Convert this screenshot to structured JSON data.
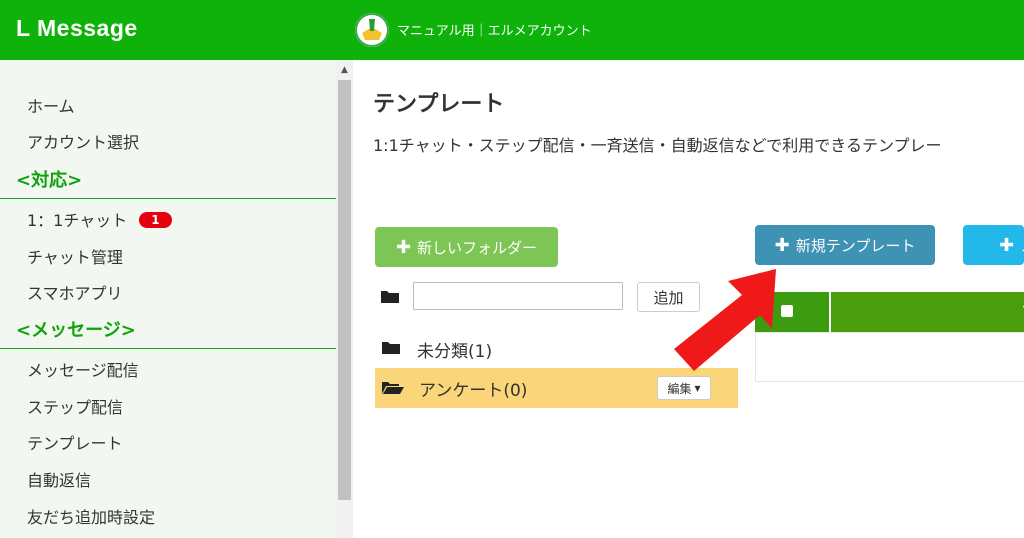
{
  "header": {
    "logo": "L Message",
    "account_name": "マニュアル用｜エルメアカウント"
  },
  "sidebar": {
    "home": "ホーム",
    "account_select": "アカウント選択",
    "section_support": "<対応>",
    "chat": "1：1チャット",
    "chat_badge": "1",
    "chat_manage": "チャット管理",
    "smartphone_app": "スマホアプリ",
    "section_message": "<メッセージ>",
    "message_delivery": "メッセージ配信",
    "step_delivery": "ステップ配信",
    "template": "テンプレート",
    "auto_reply": "自動返信",
    "friend_add_settings": "友だち追加時設定"
  },
  "main": {
    "title": "テンプレート",
    "description": "1:1チャット・ステップ配信・一斉送信・自動返信などで利用できるテンプレー",
    "new_folder_button": "新しいフォルダー",
    "new_template_button": "新規テンプレート",
    "cyan_button_label": "ノ",
    "folder_name_placeholder": "",
    "add_button": "追加",
    "folders": [
      {
        "name": "未分類(1)"
      },
      {
        "name": "アンケート(0)"
      }
    ],
    "edit_button": "編集",
    "table_header_partial": "プッ"
  },
  "colors": {
    "header_green": "#0fb20a",
    "sidebar_section_green": "#0fa30a",
    "folder_button": "#7dc655",
    "template_button": "#3e93b5",
    "active_folder": "#fbd57a",
    "badge_red": "#e6000e",
    "arrow_red": "#f01919"
  }
}
